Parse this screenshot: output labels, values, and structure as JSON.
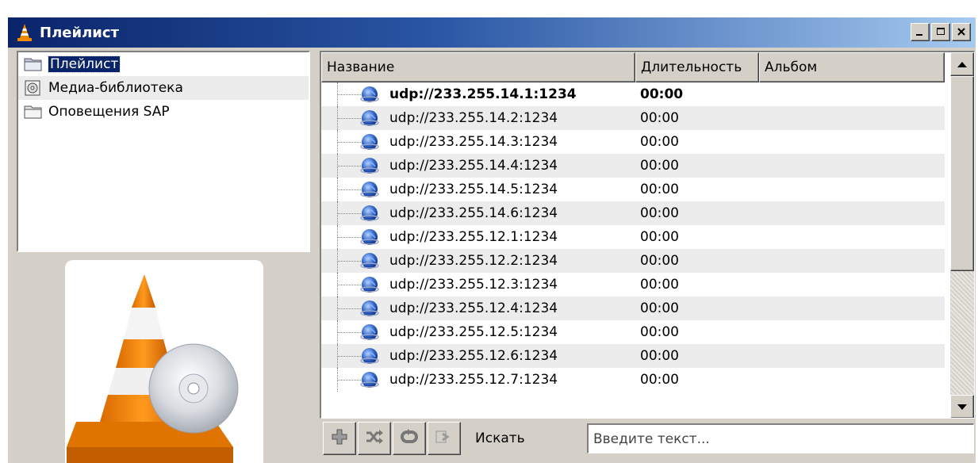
{
  "window": {
    "title": "Плейлист",
    "controls": {
      "minimize": "minimize-icon",
      "maximize": "maximize-icon",
      "close": "close-icon"
    }
  },
  "sidebar": {
    "items": [
      {
        "label": "Плейлист",
        "icon": "folder-icon",
        "selected": true
      },
      {
        "label": "Медиа-библиотека",
        "icon": "media-library-icon",
        "selected": false
      },
      {
        "label": "Оповещения SAP",
        "icon": "folder-icon",
        "selected": false
      }
    ]
  },
  "playlist": {
    "columns": {
      "name": "Название",
      "duration": "Длительность",
      "album": "Альбом"
    },
    "rows": [
      {
        "name": "udp://233.255.14.1:1234",
        "duration": "00:00",
        "current": true
      },
      {
        "name": "udp://233.255.14.2:1234",
        "duration": "00:00"
      },
      {
        "name": "udp://233.255.14.3:1234",
        "duration": "00:00"
      },
      {
        "name": "udp://233.255.14.4:1234",
        "duration": "00:00"
      },
      {
        "name": "udp://233.255.14.5:1234",
        "duration": "00:00"
      },
      {
        "name": "udp://233.255.14.6:1234",
        "duration": "00:00"
      },
      {
        "name": "udp://233.255.12.1:1234",
        "duration": "00:00"
      },
      {
        "name": "udp://233.255.12.2:1234",
        "duration": "00:00"
      },
      {
        "name": "udp://233.255.12.3:1234",
        "duration": "00:00"
      },
      {
        "name": "udp://233.255.12.4:1234",
        "duration": "00:00"
      },
      {
        "name": "udp://233.255.12.5:1234",
        "duration": "00:00"
      },
      {
        "name": "udp://233.255.12.6:1234",
        "duration": "00:00"
      },
      {
        "name": "udp://233.255.12.7:1234",
        "duration": "00:00"
      }
    ]
  },
  "toolbar": {
    "buttons": [
      "add-icon",
      "shuffle-icon",
      "repeat-icon",
      "open-icon"
    ],
    "search_label": "Искать",
    "search_placeholder": "Введите текст..."
  },
  "colors": {
    "title_gradient_start": "#0a246a",
    "title_gradient_end": "#a6caf0",
    "selection": "#0a246a",
    "face": "#d4d0c8",
    "alt_row": "#ececec"
  }
}
